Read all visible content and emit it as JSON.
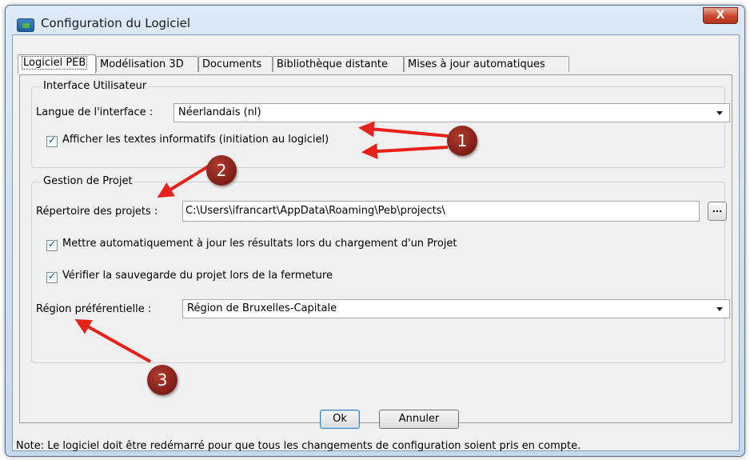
{
  "window": {
    "title": "Configuration du Logiciel",
    "close_label": "X"
  },
  "tabs": [
    {
      "label": "Logiciel PEB"
    },
    {
      "label": "Modélisation 3D"
    },
    {
      "label": "Documents"
    },
    {
      "label": "Bibliothèque distante"
    },
    {
      "label": "Mises à jour automatiques"
    }
  ],
  "interface": {
    "group_title": "Interface Utilisateur",
    "language_label": "Langue de l'interface :",
    "language_value": "Néerlandais (nl)",
    "show_texts_label": "Afficher les textes informatifs (initiation au logiciel)"
  },
  "project": {
    "group_title": "Gestion de Projet",
    "dir_label": "Répertoire des projets :",
    "dir_value": "C:\\Users\\ifrancart\\AppData\\Roaming\\Peb\\projects\\",
    "browse_label": "...",
    "auto_update_label": "Mettre automatiquement à jour les résultats lors du chargement d'un Projet",
    "verify_save_label": "Vérifier la sauvegarde du projet lors de la fermeture",
    "region_label": "Région préférentielle :",
    "region_value": "Région de Bruxelles-Capitale"
  },
  "buttons": {
    "ok": "Ok",
    "cancel": "Annuler"
  },
  "note": "Note: Le logiciel doit être redémarré pour que tous les changements de configuration soient pris en compte.",
  "annotations": [
    {
      "label": "1"
    },
    {
      "label": "2"
    },
    {
      "label": "3"
    }
  ],
  "colors": {
    "accent": "#3c7fb1",
    "marker": "#8b2419",
    "arrow": "#e8211b"
  }
}
